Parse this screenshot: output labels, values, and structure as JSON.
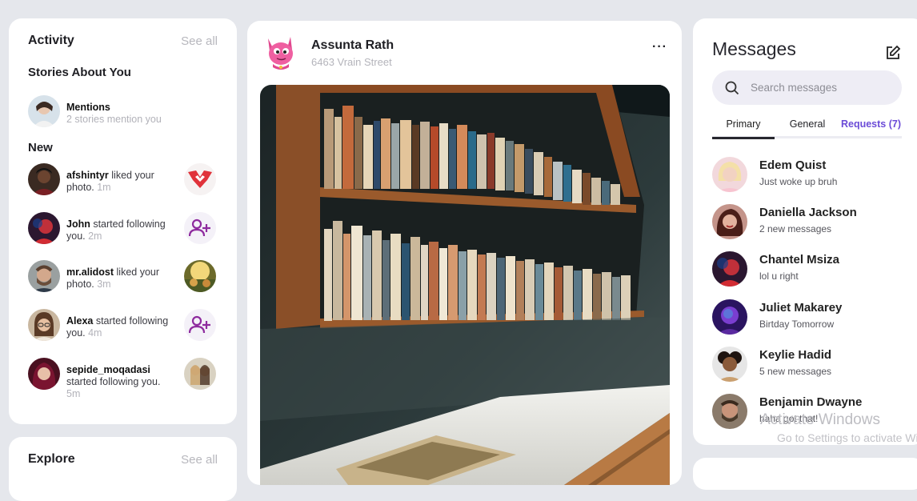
{
  "activity": {
    "title": "Activity",
    "see_all": "See all",
    "stories_title": "Stories About You",
    "mentions": {
      "label": "Mentions",
      "sub": "2 stories mention you"
    },
    "new_title": "New",
    "items": [
      {
        "user": "afshintyr",
        "action": " liked your photo. ",
        "time": "1m",
        "thumb_icon": "logo-icon"
      },
      {
        "user": "John",
        "action": " started following you. ",
        "time": "2m",
        "thumb_icon": "add-user-icon"
      },
      {
        "user": "mr.alidost",
        "action": " liked your photo. ",
        "time": "3m",
        "thumb_icon": "photo-thumbnail"
      },
      {
        "user": "Alexa",
        "action": " started following you. ",
        "time": "4m",
        "thumb_icon": "add-user-icon"
      },
      {
        "user": "sepide_moqadasi",
        "action": " started following you. ",
        "time": "5m",
        "thumb_icon": "photo-thumbnail"
      }
    ]
  },
  "explore": {
    "title": "Explore",
    "see_all": "See all"
  },
  "post": {
    "author": "Assunta Rath",
    "address": "6463 Vrain Street",
    "more_label": "···"
  },
  "messages": {
    "title": "Messages",
    "search_placeholder": "Search messages",
    "tabs": [
      "Primary",
      "General",
      "Requests (7)"
    ],
    "list": [
      {
        "name": "Edem Quist",
        "preview": "Just woke up bruh"
      },
      {
        "name": "Daniella Jackson",
        "preview": "2 new messages"
      },
      {
        "name": "Chantel Msiza",
        "preview": "lol u right"
      },
      {
        "name": "Juliet Makarey",
        "preview": "Birtday Tomorrow"
      },
      {
        "name": "Keylie Hadid",
        "preview": "5 new messages"
      },
      {
        "name": "Benjamin Dwayne",
        "preview": "haha got that!"
      }
    ]
  },
  "watermark": {
    "line1": "Activate Windows",
    "line2": "Go to Settings to activate Windows."
  },
  "colors": {
    "accent": "#6b4bd7",
    "add_user_icon": "#8e2a9e",
    "logo_red": "#e0323a"
  }
}
